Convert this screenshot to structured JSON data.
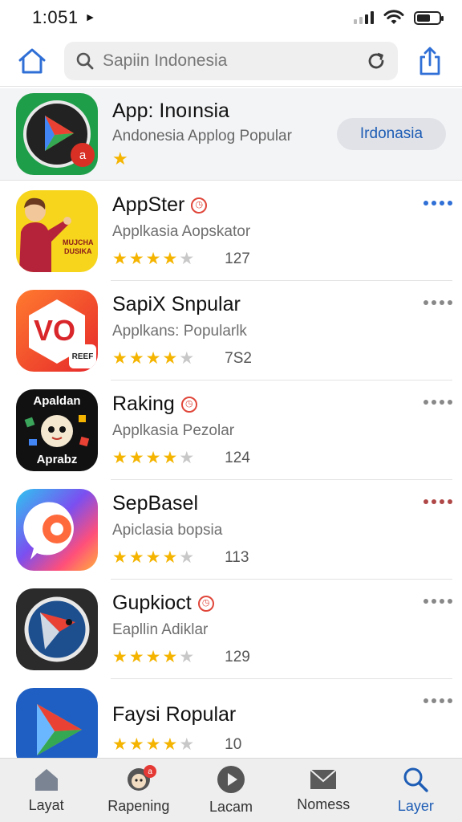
{
  "status_bar": {
    "time": "1:051",
    "location_arrow": "►"
  },
  "nav": {
    "search_placeholder": "Sapiin Indonesia",
    "icons": [
      "home-icon",
      "search-icon",
      "refresh-icon",
      "share-icon"
    ]
  },
  "featured": {
    "title": "App: Inoınsia",
    "subtitle": "Andonesia Applog Popular",
    "rating_stars": 1,
    "button_label": "Irdonasia",
    "icon_badge": "a"
  },
  "apps": [
    {
      "name": "AppSter",
      "subtitle": "Applkasia Aopskator",
      "rating": 4,
      "count": "127",
      "has_badge": true,
      "icon_text_1": "MUJCHA",
      "icon_text_2": "DUSIKA"
    },
    {
      "name": "SapiX Snpular",
      "subtitle": "Applkans: Popularlk",
      "rating": 4,
      "count": "7S2",
      "has_badge": false,
      "icon_text_1": "VO",
      "icon_text_2": "REEF"
    },
    {
      "name": "Raking",
      "subtitle": "Applkasia Pezolar",
      "rating": 4,
      "count": "124",
      "has_badge": true,
      "icon_text_1": "Apaldan",
      "icon_text_2": "Aprabz"
    },
    {
      "name": "SepBasel",
      "subtitle": "Apiclasia bopsia",
      "rating": 4,
      "count": "113",
      "has_badge": false
    },
    {
      "name": "Gupkioct",
      "subtitle": "Eapllin Adiklar",
      "rating": 4,
      "count": "129",
      "has_badge": true
    },
    {
      "name": "Faysi Ropular",
      "subtitle": "",
      "rating": 4,
      "count": "10",
      "has_badge": false
    }
  ],
  "tabs": [
    {
      "label": "Layat",
      "icon": "home-icon"
    },
    {
      "label": "Rapening",
      "icon": "avatar-icon",
      "badge": "a"
    },
    {
      "label": "Lacam",
      "icon": "play-icon"
    },
    {
      "label": "Nomess",
      "icon": "mail-icon"
    },
    {
      "label": "Layer",
      "icon": "search-icon"
    }
  ],
  "colors": {
    "accent": "#1e5db5",
    "star": "#f4b400",
    "badge": "#e0463a"
  }
}
